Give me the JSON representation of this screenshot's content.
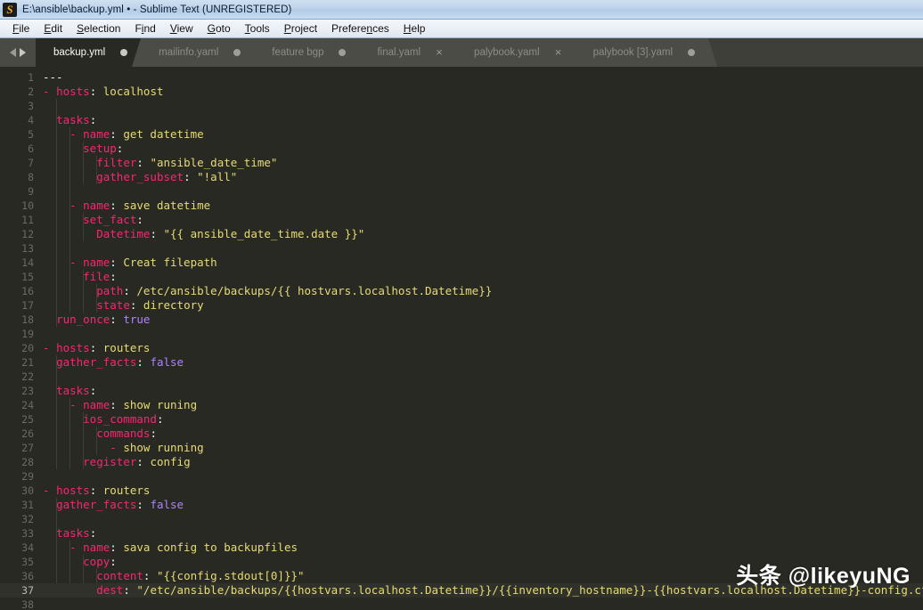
{
  "window": {
    "title": "E:\\ansible\\backup.yml • - Sublime Text (UNREGISTERED)",
    "icon": "sublime-text-icon"
  },
  "menubar": {
    "items": [
      {
        "label": "File",
        "mnemonic": "F"
      },
      {
        "label": "Edit",
        "mnemonic": "E"
      },
      {
        "label": "Selection",
        "mnemonic": "S"
      },
      {
        "label": "Find",
        "mnemonic": "i"
      },
      {
        "label": "View",
        "mnemonic": "V"
      },
      {
        "label": "Goto",
        "mnemonic": "G"
      },
      {
        "label": "Tools",
        "mnemonic": "T"
      },
      {
        "label": "Project",
        "mnemonic": "P"
      },
      {
        "label": "Preferences",
        "mnemonic": "n"
      },
      {
        "label": "Help",
        "mnemonic": "H"
      }
    ]
  },
  "tabbar": {
    "nav_prev_icon": "chevron-left-icon",
    "nav_next_icon": "chevron-right-icon",
    "tabs": [
      {
        "label": "backup.yml",
        "active": true,
        "marker": "dot"
      },
      {
        "label": "mailinfo.yaml",
        "active": false,
        "marker": "dot"
      },
      {
        "label": "feature bgp",
        "active": false,
        "marker": "dot"
      },
      {
        "label": "final.yaml",
        "active": false,
        "marker": "close"
      },
      {
        "label": "palybook.yaml",
        "active": false,
        "marker": "close"
      },
      {
        "label": "palybook [3].yaml",
        "active": false,
        "marker": "dot"
      }
    ]
  },
  "editor": {
    "language": "YAML",
    "theme": "Monokai",
    "background": "#282923",
    "active_line": 37,
    "colors": {
      "key": "#f92672",
      "string": "#e6db74",
      "constant": "#ae81ff",
      "plain": "#f8f8f2",
      "gutter": "#6b6b62",
      "active_line_bg": "#30312a"
    },
    "lines": [
      {
        "n": 1,
        "tokens": [
          {
            "t": "---",
            "c": "p"
          }
        ]
      },
      {
        "n": 2,
        "tokens": [
          {
            "t": "- ",
            "c": "d"
          },
          {
            "t": "hosts",
            "c": "k"
          },
          {
            "t": ": ",
            "c": "p"
          },
          {
            "t": "localhost",
            "c": "s"
          }
        ]
      },
      {
        "n": 3,
        "tokens": []
      },
      {
        "n": 4,
        "tokens": [
          {
            "t": "  ",
            "c": "p"
          },
          {
            "t": "tasks",
            "c": "k"
          },
          {
            "t": ":",
            "c": "p"
          }
        ]
      },
      {
        "n": 5,
        "tokens": [
          {
            "t": "    - ",
            "c": "d"
          },
          {
            "t": "name",
            "c": "k"
          },
          {
            "t": ": ",
            "c": "p"
          },
          {
            "t": "get datetime",
            "c": "s"
          }
        ]
      },
      {
        "n": 6,
        "tokens": [
          {
            "t": "      ",
            "c": "p"
          },
          {
            "t": "setup",
            "c": "k"
          },
          {
            "t": ":",
            "c": "p"
          }
        ]
      },
      {
        "n": 7,
        "tokens": [
          {
            "t": "        ",
            "c": "p"
          },
          {
            "t": "filter",
            "c": "k"
          },
          {
            "t": ": ",
            "c": "p"
          },
          {
            "t": "\"ansible_date_time\"",
            "c": "s"
          }
        ]
      },
      {
        "n": 8,
        "tokens": [
          {
            "t": "        ",
            "c": "p"
          },
          {
            "t": "gather_subset",
            "c": "k"
          },
          {
            "t": ": ",
            "c": "p"
          },
          {
            "t": "\"!all\"",
            "c": "s"
          }
        ]
      },
      {
        "n": 9,
        "tokens": []
      },
      {
        "n": 10,
        "tokens": [
          {
            "t": "    - ",
            "c": "d"
          },
          {
            "t": "name",
            "c": "k"
          },
          {
            "t": ": ",
            "c": "p"
          },
          {
            "t": "save datetime",
            "c": "s"
          }
        ]
      },
      {
        "n": 11,
        "tokens": [
          {
            "t": "      ",
            "c": "p"
          },
          {
            "t": "set_fact",
            "c": "k"
          },
          {
            "t": ":",
            "c": "p"
          }
        ]
      },
      {
        "n": 12,
        "tokens": [
          {
            "t": "        ",
            "c": "p"
          },
          {
            "t": "Datetime",
            "c": "k"
          },
          {
            "t": ": ",
            "c": "p"
          },
          {
            "t": "\"{{ ansible_date_time.date }}\"",
            "c": "s"
          }
        ]
      },
      {
        "n": 13,
        "tokens": []
      },
      {
        "n": 14,
        "tokens": [
          {
            "t": "    - ",
            "c": "d"
          },
          {
            "t": "name",
            "c": "k"
          },
          {
            "t": ": ",
            "c": "p"
          },
          {
            "t": "Creat filepath",
            "c": "s"
          }
        ]
      },
      {
        "n": 15,
        "tokens": [
          {
            "t": "      ",
            "c": "p"
          },
          {
            "t": "file",
            "c": "k"
          },
          {
            "t": ":",
            "c": "p"
          }
        ]
      },
      {
        "n": 16,
        "tokens": [
          {
            "t": "        ",
            "c": "p"
          },
          {
            "t": "path",
            "c": "k"
          },
          {
            "t": ": ",
            "c": "p"
          },
          {
            "t": "/etc/ansible/backups/{{ hostvars.localhost.Datetime}}",
            "c": "s"
          }
        ]
      },
      {
        "n": 17,
        "tokens": [
          {
            "t": "        ",
            "c": "p"
          },
          {
            "t": "state",
            "c": "k"
          },
          {
            "t": ": ",
            "c": "p"
          },
          {
            "t": "directory",
            "c": "s"
          }
        ]
      },
      {
        "n": 18,
        "tokens": [
          {
            "t": "  ",
            "c": "p"
          },
          {
            "t": "run_once",
            "c": "k"
          },
          {
            "t": ": ",
            "c": "p"
          },
          {
            "t": "true",
            "c": "c"
          }
        ]
      },
      {
        "n": 19,
        "tokens": []
      },
      {
        "n": 20,
        "tokens": [
          {
            "t": "- ",
            "c": "d"
          },
          {
            "t": "hosts",
            "c": "k"
          },
          {
            "t": ": ",
            "c": "p"
          },
          {
            "t": "routers",
            "c": "s"
          }
        ]
      },
      {
        "n": 21,
        "tokens": [
          {
            "t": "  ",
            "c": "p"
          },
          {
            "t": "gather_facts",
            "c": "k"
          },
          {
            "t": ": ",
            "c": "p"
          },
          {
            "t": "false",
            "c": "c"
          }
        ]
      },
      {
        "n": 22,
        "tokens": []
      },
      {
        "n": 23,
        "tokens": [
          {
            "t": "  ",
            "c": "p"
          },
          {
            "t": "tasks",
            "c": "k"
          },
          {
            "t": ":",
            "c": "p"
          }
        ]
      },
      {
        "n": 24,
        "tokens": [
          {
            "t": "    - ",
            "c": "d"
          },
          {
            "t": "name",
            "c": "k"
          },
          {
            "t": ": ",
            "c": "p"
          },
          {
            "t": "show runing",
            "c": "s"
          }
        ]
      },
      {
        "n": 25,
        "tokens": [
          {
            "t": "      ",
            "c": "p"
          },
          {
            "t": "ios_command",
            "c": "k"
          },
          {
            "t": ":",
            "c": "p"
          }
        ]
      },
      {
        "n": 26,
        "tokens": [
          {
            "t": "        ",
            "c": "p"
          },
          {
            "t": "commands",
            "c": "k"
          },
          {
            "t": ":",
            "c": "p"
          }
        ]
      },
      {
        "n": 27,
        "tokens": [
          {
            "t": "          - ",
            "c": "d"
          },
          {
            "t": "show running",
            "c": "s"
          }
        ]
      },
      {
        "n": 28,
        "tokens": [
          {
            "t": "      ",
            "c": "p"
          },
          {
            "t": "register",
            "c": "k"
          },
          {
            "t": ": ",
            "c": "p"
          },
          {
            "t": "config",
            "c": "s"
          }
        ]
      },
      {
        "n": 29,
        "tokens": []
      },
      {
        "n": 30,
        "tokens": [
          {
            "t": "- ",
            "c": "d"
          },
          {
            "t": "hosts",
            "c": "k"
          },
          {
            "t": ": ",
            "c": "p"
          },
          {
            "t": "routers",
            "c": "s"
          }
        ]
      },
      {
        "n": 31,
        "tokens": [
          {
            "t": "  ",
            "c": "p"
          },
          {
            "t": "gather_facts",
            "c": "k"
          },
          {
            "t": ": ",
            "c": "p"
          },
          {
            "t": "false",
            "c": "c"
          }
        ]
      },
      {
        "n": 32,
        "tokens": []
      },
      {
        "n": 33,
        "tokens": [
          {
            "t": "  ",
            "c": "p"
          },
          {
            "t": "tasks",
            "c": "k"
          },
          {
            "t": ":",
            "c": "p"
          }
        ]
      },
      {
        "n": 34,
        "tokens": [
          {
            "t": "    - ",
            "c": "d"
          },
          {
            "t": "name",
            "c": "k"
          },
          {
            "t": ": ",
            "c": "p"
          },
          {
            "t": "sava config to backupfiles",
            "c": "s"
          }
        ]
      },
      {
        "n": 35,
        "tokens": [
          {
            "t": "      ",
            "c": "p"
          },
          {
            "t": "copy",
            "c": "k"
          },
          {
            "t": ":",
            "c": "p"
          }
        ]
      },
      {
        "n": 36,
        "tokens": [
          {
            "t": "        ",
            "c": "p"
          },
          {
            "t": "content",
            "c": "k"
          },
          {
            "t": ": ",
            "c": "p"
          },
          {
            "t": "\"{{config.stdout[0]}}\"",
            "c": "s"
          }
        ]
      },
      {
        "n": 37,
        "tokens": [
          {
            "t": "        ",
            "c": "p"
          },
          {
            "t": "dest",
            "c": "k"
          },
          {
            "t": ": ",
            "c": "p"
          },
          {
            "t": "\"/etc/ansible/backups/{{hostvars.localhost.Datetime}}/{{inventory_hostname}}-{{hostvars.localhost.Datetime}}-config.cfg",
            "c": "s"
          }
        ]
      },
      {
        "n": 38,
        "tokens": []
      }
    ]
  },
  "watermark": {
    "text": "头条 @likeyuNG"
  }
}
